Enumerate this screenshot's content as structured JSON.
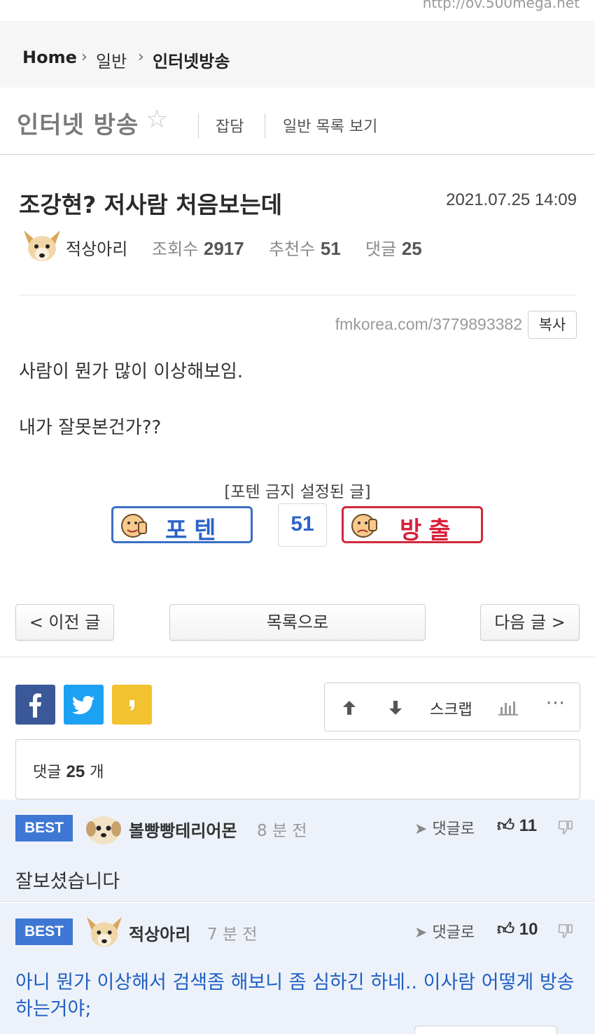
{
  "url_strip": {
    "text": "http://ov.500mega.net"
  },
  "breadcrumb": {
    "home": "Home",
    "level1": "일반",
    "level2": "인터넷방송"
  },
  "board": {
    "title": "인터넷 방송",
    "link1": "잡담",
    "link2": "일반 목록 보기"
  },
  "article": {
    "title": "조강현? 저사람 처음보는데",
    "date": "2021.07.25 14:09",
    "author": "적상아리",
    "views_label": "조회수",
    "views": "2917",
    "recommend_label": "추천수",
    "recommend": "51",
    "comments_label": "댓글",
    "comments": "25",
    "source_url": "fmkorea.com/3779893382",
    "copy_label": "복사",
    "body": [
      "사람이 뭔가 많이 이상해보임.",
      "내가 잘못본건가??"
    ]
  },
  "vote": {
    "note": "[포텐 금지 설정된 글]",
    "up_label": "포텐",
    "down_label": "방출",
    "count": "51"
  },
  "nav": {
    "prev": "< 이전 글",
    "list": "목록으로",
    "next": "다음 글 >"
  },
  "tools": {
    "scrap": "스크랩"
  },
  "comment_count": {
    "label": "댓글",
    "count": "25",
    "unit": "개"
  },
  "comments": [
    {
      "badge": "BEST",
      "name": "볼빵빵테리어몬",
      "time": "8 분 전",
      "reply": "댓글로",
      "likes": "11",
      "text": "잘보셨습니다",
      "text_color": "#333333"
    },
    {
      "badge": "BEST",
      "name": "적상아리",
      "time": "7 분 전",
      "reply": "댓글로",
      "likes": "10",
      "text": "아니 뭔가 이상해서 검색좀 해보니 좀 심하긴 하네.. 이사람 어떻게 방송하는거야;",
      "text_color": "#1f5fc4"
    }
  ],
  "colors": {
    "accent_blue": "#3f78d4",
    "down_red": "#d8213a",
    "comment_bg": "#edf2fa"
  }
}
